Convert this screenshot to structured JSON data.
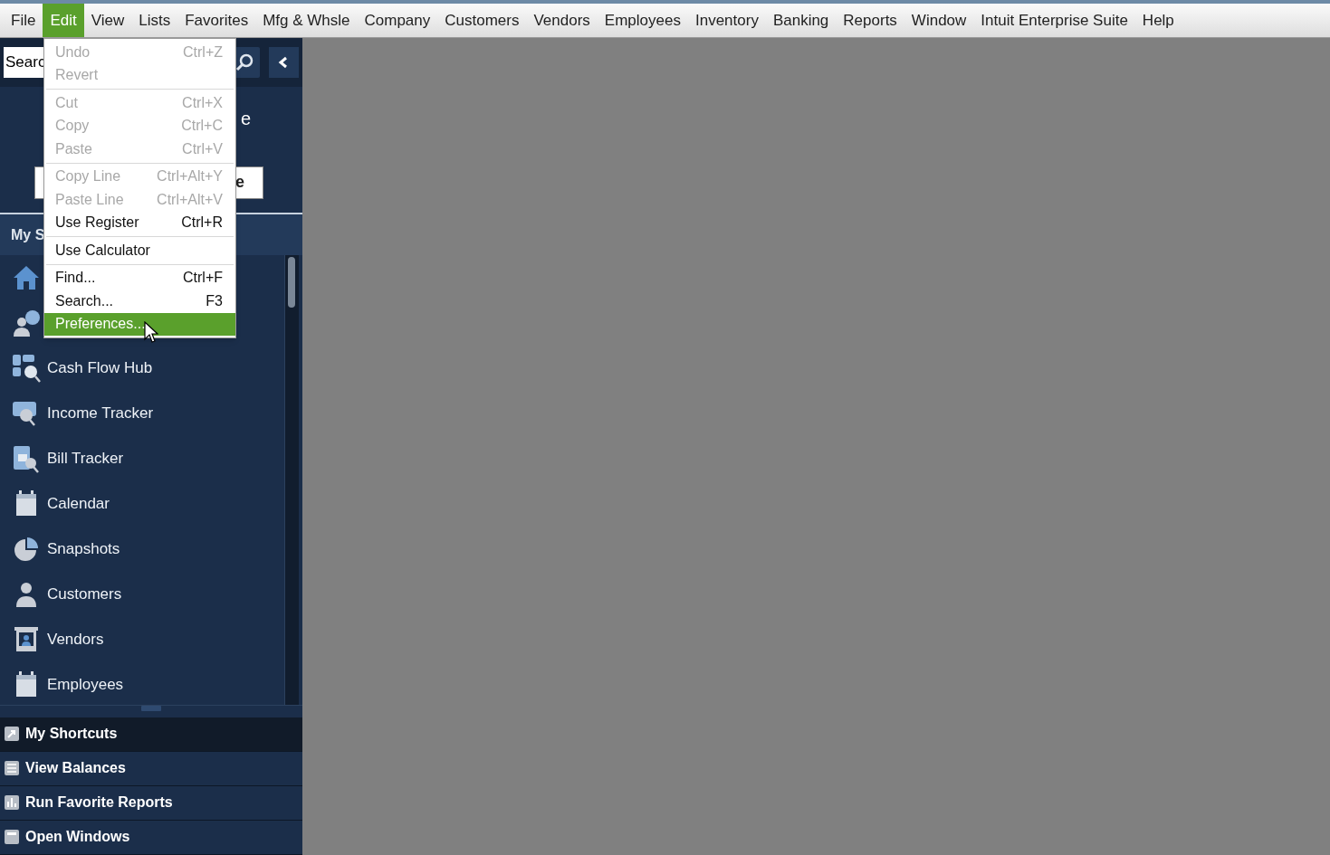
{
  "menubar": [
    {
      "label": "File",
      "selected": false
    },
    {
      "label": "Edit",
      "selected": true
    },
    {
      "label": "View",
      "selected": false
    },
    {
      "label": "Lists",
      "selected": false
    },
    {
      "label": "Favorites",
      "selected": false
    },
    {
      "label": "Mfg & Whsle",
      "selected": false
    },
    {
      "label": "Company",
      "selected": false
    },
    {
      "label": "Customers",
      "selected": false
    },
    {
      "label": "Vendors",
      "selected": false
    },
    {
      "label": "Employees",
      "selected": false
    },
    {
      "label": "Inventory",
      "selected": false
    },
    {
      "label": "Banking",
      "selected": false
    },
    {
      "label": "Reports",
      "selected": false
    },
    {
      "label": "Window",
      "selected": false
    },
    {
      "label": "Intuit Enterprise Suite",
      "selected": false
    },
    {
      "label": "Help",
      "selected": false
    }
  ],
  "edit_menu": [
    {
      "kind": "item",
      "label": "Undo",
      "shortcut": "Ctrl+Z",
      "disabled": true,
      "selected": false
    },
    {
      "kind": "item",
      "label": "Revert",
      "disabled": true,
      "selected": false
    },
    {
      "kind": "separator"
    },
    {
      "kind": "item",
      "label": "Cut",
      "shortcut": "Ctrl+X",
      "disabled": true,
      "selected": false
    },
    {
      "kind": "item",
      "label": "Copy",
      "shortcut": "Ctrl+C",
      "disabled": true,
      "selected": false
    },
    {
      "kind": "item",
      "label": "Paste",
      "shortcut": "Ctrl+V",
      "disabled": true,
      "selected": false
    },
    {
      "kind": "separator"
    },
    {
      "kind": "item",
      "label": "Copy Line",
      "shortcut": "Ctrl+Alt+Y",
      "disabled": true,
      "selected": false
    },
    {
      "kind": "item",
      "label": "Paste Line",
      "shortcut": "Ctrl+Alt+V",
      "disabled": true,
      "selected": false
    },
    {
      "kind": "item",
      "label": "Use Register",
      "shortcut": "Ctrl+R",
      "disabled": false,
      "selected": false
    },
    {
      "kind": "separator"
    },
    {
      "kind": "item",
      "label": "Use Calculator",
      "disabled": false,
      "selected": false
    },
    {
      "kind": "separator"
    },
    {
      "kind": "item",
      "label": "Find...",
      "shortcut": "Ctrl+F",
      "disabled": false,
      "selected": false
    },
    {
      "kind": "item",
      "label": "Search...",
      "shortcut": "F3",
      "disabled": false,
      "selected": false
    },
    {
      "kind": "item",
      "label": "Preferences...",
      "disabled": false,
      "selected": true
    }
  ],
  "sidebar": {
    "search": {
      "value": "Searc"
    },
    "header_text": "e",
    "header_button": "e",
    "tab_label": "My S",
    "items": [
      {
        "kind": "home"
      },
      {
        "kind": "company"
      },
      {
        "kind": "cashflow",
        "label": "Cash Flow Hub"
      },
      {
        "kind": "income",
        "label": "Income Tracker"
      },
      {
        "kind": "bill",
        "label": "Bill Tracker"
      },
      {
        "kind": "calendar",
        "label": "Calendar"
      },
      {
        "kind": "snapshot",
        "label": "Snapshots"
      },
      {
        "kind": "person",
        "label": "Customers"
      },
      {
        "kind": "vendor",
        "label": "Vendors"
      },
      {
        "kind": "calendar",
        "label": "Employees"
      }
    ],
    "sections": [
      {
        "label": "My Shortcuts",
        "selected": true,
        "kind": "shortcut"
      },
      {
        "label": "View Balances",
        "selected": false,
        "kind": "balances"
      },
      {
        "label": "Run Favorite Reports",
        "selected": false,
        "kind": "reports"
      },
      {
        "label": "Open Windows",
        "selected": false,
        "kind": "window"
      }
    ]
  }
}
